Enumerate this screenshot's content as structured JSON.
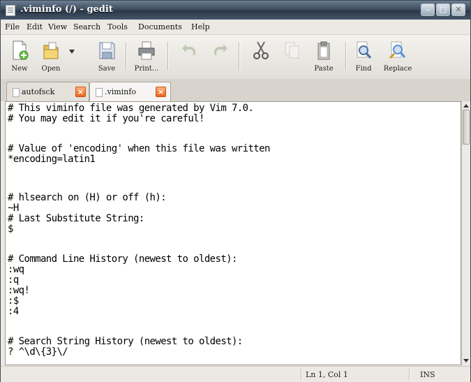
{
  "window": {
    "title": ".viminfo (/) - gedit"
  },
  "menu": [
    "File",
    "Edit",
    "View",
    "Search",
    "Tools",
    "Documents",
    "Help"
  ],
  "toolbar": {
    "new_label": "New",
    "open_label": "Open",
    "save_label": "Save",
    "print_label": "Print...",
    "paste_label": "Paste",
    "find_label": "Find",
    "replace_label": "Replace"
  },
  "tabs": [
    {
      "label": "autofsck",
      "active": false
    },
    {
      "label": ".viminfo",
      "active": true
    }
  ],
  "editor": {
    "lines": [
      "# This viminfo file was generated by Vim 7.0.",
      "# You may edit it if you're careful!",
      "",
      "# Value of 'encoding' when this file was written",
      "*encoding=latin1",
      "",
      "",
      "# hlsearch on (H) or off (h):",
      "~H",
      "# Last Substitute String:",
      "$",
      "",
      "# Command Line History (newest to oldest):",
      ":wq",
      ":q",
      ":wq!",
      ":$",
      ":4",
      "",
      "# Search String History (newest to oldest):",
      "? ^\\d\\{3}\\/"
    ]
  },
  "status": {
    "position": "Ln 1, Col 1",
    "mode": "INS"
  },
  "colors": {
    "titlebar": "#3d4d60",
    "tab_close": "#e9621e",
    "accent_icon": "#5a8fd6"
  }
}
